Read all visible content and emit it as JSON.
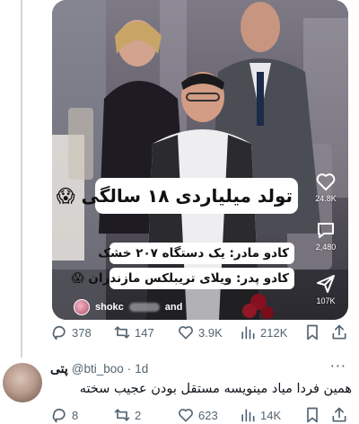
{
  "video": {
    "caption_title": "تولد میلیاردی ۱۸ سالگی 😱",
    "caption_line1": "کادو مادر: یک دستگاه ۲۰۷ خشک",
    "caption_line2": "کادو پدر: ویلای تریبلکس مازندران 😱",
    "uploader_handle": "shokc",
    "uploader_suffix": "and",
    "side": {
      "likes": "24.8K",
      "comments": "2,480",
      "shares": "107K"
    },
    "icons": [
      "heart-icon",
      "comment-bubble-icon",
      "share-arrow-icon"
    ]
  },
  "tweet_actions": {
    "replies": "378",
    "retweets": "147",
    "likes": "3.9K",
    "views": "212K"
  },
  "reply": {
    "name": "پتی",
    "handle": "@bti_boo",
    "time": "1d",
    "separator": "·",
    "more": "···",
    "text": "همین فردا میاد مینویسه مستقل بودن عجیب سخته",
    "actions": {
      "replies": "8",
      "retweets": "2",
      "likes": "623",
      "views": "14K"
    }
  },
  "colors": {
    "muted": "#536471",
    "text": "#0f1419",
    "thread_line": "#cfd9de"
  }
}
